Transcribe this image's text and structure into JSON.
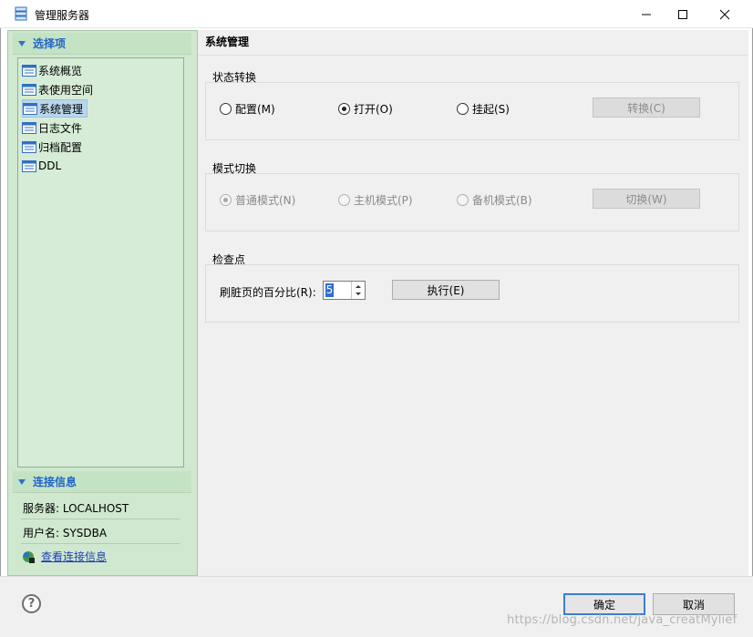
{
  "window": {
    "title": "管理服务器",
    "icons": {
      "app": "server-icon",
      "minimize": "minimize-icon",
      "maximize": "maximize-icon",
      "close": "close-icon"
    }
  },
  "sidebar": {
    "section_title": "选择项",
    "items": [
      {
        "label": "系统概览",
        "icon": "list-icon"
      },
      {
        "label": "表使用空间",
        "icon": "list-icon"
      },
      {
        "label": "系统管理",
        "icon": "list-icon",
        "selected": true
      },
      {
        "label": "日志文件",
        "icon": "list-icon"
      },
      {
        "label": "归档配置",
        "icon": "list-icon"
      },
      {
        "label": "DDL",
        "icon": "list-icon"
      }
    ]
  },
  "connection": {
    "section_title": "连接信息",
    "server": "服务器: LOCALHOST",
    "user": "用户名: SYSDBA",
    "link": "查看连接信息"
  },
  "main": {
    "title": "系统管理",
    "state": {
      "group_title": "状态转换",
      "options": [
        "配置(M)",
        "打开(O)",
        "挂起(S)"
      ],
      "selected": "打开(O)",
      "button": "转换(C)"
    },
    "mode": {
      "group_title": "模式切换",
      "options": [
        "普通模式(N)",
        "主机模式(P)",
        "备机模式(B)"
      ],
      "selected": "普通模式(N)",
      "button": "切换(W)"
    },
    "checkpoint": {
      "group_title": "检查点",
      "label": "刷脏页的百分比(R):",
      "value": "5",
      "button": "执行(E)"
    }
  },
  "footer": {
    "help": "?",
    "ok": "确定",
    "cancel": "取消",
    "watermark": "https://blog.csdn.net/java_creatMylief"
  },
  "colors": {
    "accent": "#1e64c8",
    "sidebar_bg": "#cfe8cf",
    "selected_item": "#b9d7ec",
    "primary_button_border": "#3c7ed0"
  }
}
